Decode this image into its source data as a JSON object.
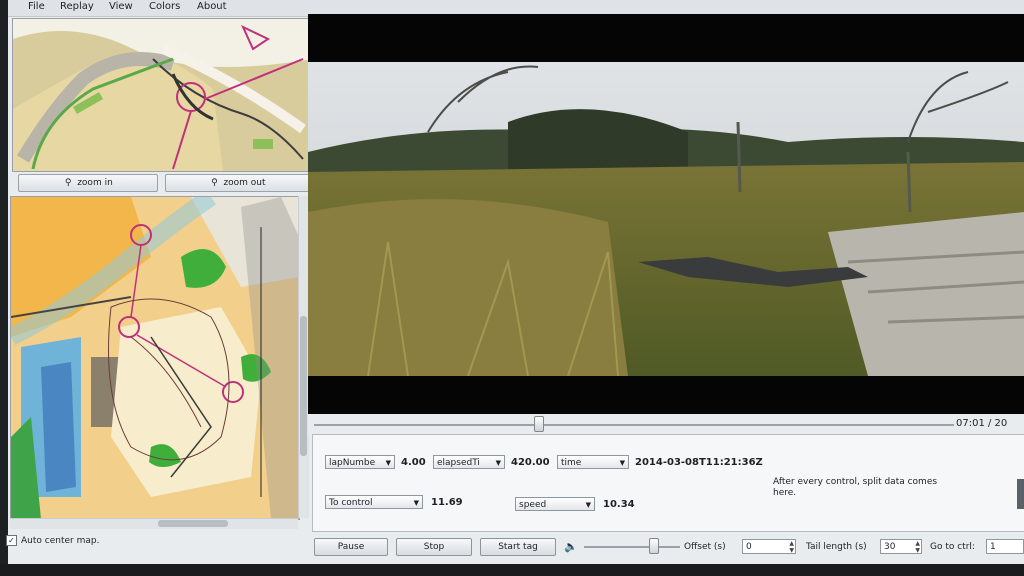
{
  "menu": [
    "File",
    "Replay",
    "View",
    "Colors",
    "About"
  ],
  "zoom": {
    "in_label": "zoom in",
    "out_label": "zoom out"
  },
  "auto_center": {
    "label": "Auto center map.",
    "checked": true
  },
  "seek": {
    "time": "07:01  /  20",
    "progress": 0.35
  },
  "data_panel": {
    "row1": {
      "field1": "lapNumbe",
      "value1": "4.00",
      "field2": "elapsedTi",
      "value2": "420.00",
      "field3": "time",
      "value3": "2014-03-08T11:21:36Z"
    },
    "row2": {
      "field1": "To control",
      "value1": "11.69",
      "field2": "speed",
      "value2": "10.34"
    },
    "note": "After every control, split data comes here."
  },
  "controls": {
    "pause": "Pause",
    "stop": "Stop",
    "start_tag": "Start tag",
    "volume": 0.72,
    "offset_label": "Offset (s)",
    "offset_value": "0",
    "tail_label": "Tail length (s)",
    "tail_value": "30",
    "goto_label": "Go to ctrl:",
    "goto_value": "1"
  }
}
